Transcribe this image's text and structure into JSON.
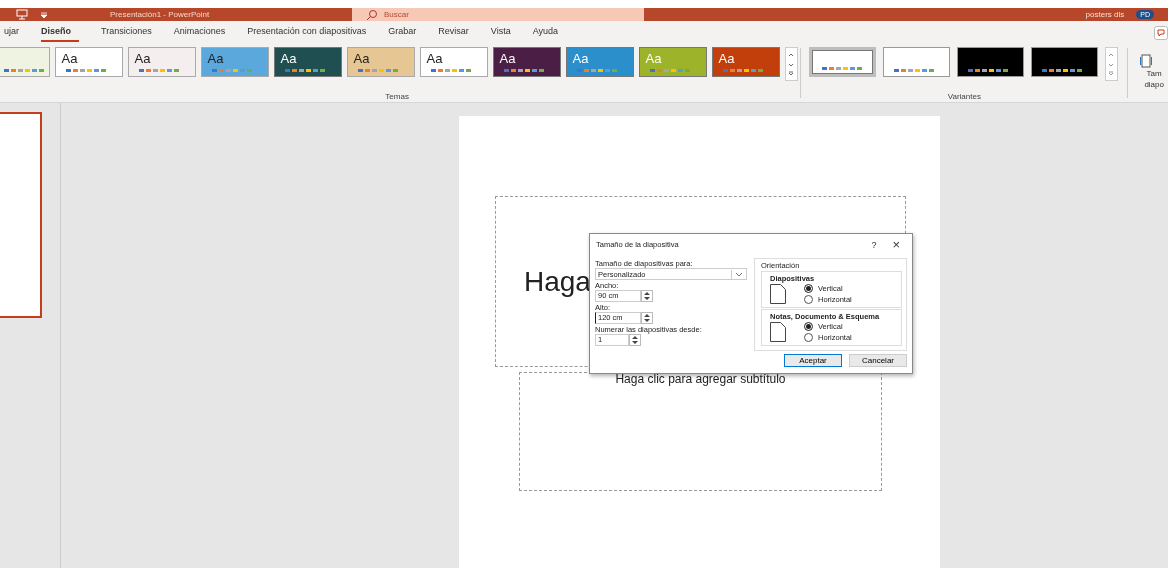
{
  "title_bar": {
    "title": "Presentación1  -  PowerPoint",
    "search_placeholder": "Buscar",
    "user_name": "posters dls",
    "avatar_initials": "PD"
  },
  "tabs": [
    {
      "label": "ujar",
      "selected": false
    },
    {
      "label": "Diseño",
      "selected": true
    },
    {
      "label": "Transiciones",
      "selected": false
    },
    {
      "label": "Animaciones",
      "selected": false
    },
    {
      "label": "Presentación con diapositivas",
      "selected": false
    },
    {
      "label": "Grabar",
      "selected": false
    },
    {
      "label": "Revisar",
      "selected": false
    },
    {
      "label": "Vista",
      "selected": false
    },
    {
      "label": "Ayuda",
      "selected": false
    }
  ],
  "themes": {
    "label": "Temas",
    "items": [
      {
        "color": "#eef3e2",
        "kind": "light"
      },
      {
        "label": "Aa",
        "color": "#ffffff",
        "kind": "light"
      },
      {
        "label": "Aa",
        "color": "#f4eeee",
        "kind": "light"
      },
      {
        "label": "Aa",
        "color": "#5aa8dc",
        "kind": "light"
      },
      {
        "label": "Aa",
        "color": "#1f4f50",
        "kind": "dark"
      },
      {
        "label": "Aa",
        "color": "#e6c692",
        "kind": "light"
      },
      {
        "label": "Aa",
        "color": "#ffffff",
        "kind": "light"
      },
      {
        "label": "Aa",
        "color": "#4b1f45",
        "kind": "dark"
      },
      {
        "label": "Aa",
        "color": "#2b8fcc",
        "kind": "dark"
      },
      {
        "label": "Aa",
        "color": "#9db42a",
        "kind": "dark"
      },
      {
        "label": "Aa",
        "color": "#c23f0c",
        "kind": "dark"
      }
    ]
  },
  "variants": {
    "label": "Variantes",
    "items": [
      {
        "color": "#ffffff",
        "selected": true
      },
      {
        "color": "#ffffff",
        "selected": false
      },
      {
        "color": "#000000",
        "selected": false
      },
      {
        "color": "#000000",
        "selected": false
      }
    ]
  },
  "slide_size_button": {
    "label": "Tam diapo"
  },
  "slide": {
    "title_placeholder": "Haga",
    "subtitle_placeholder": "Haga clic para agregar subtítulo"
  },
  "dialog": {
    "title": "Tamaño de la diapositiva",
    "help": "?",
    "close": "×",
    "size_label": "Tamaño de diapositivas para:",
    "size_value": "Personalizado",
    "width_label": "Ancho:",
    "width_value": "90 cm",
    "height_label": "Alto:",
    "height_value": "120 cm",
    "number_label": "Numerar las diapositivas desde:",
    "number_value": "1",
    "orientation_label": "Orientación",
    "groups": [
      {
        "label": "Diapositivas",
        "options": [
          {
            "label": "Vertical",
            "selected": true
          },
          {
            "label": "Horizontal",
            "selected": false
          }
        ]
      },
      {
        "label": "Notas, Documento & Esquema",
        "options": [
          {
            "label": "Vertical",
            "selected": true
          },
          {
            "label": "Horizontal",
            "selected": false
          }
        ]
      }
    ],
    "ok": "Aceptar",
    "cancel": "Cancelar"
  }
}
